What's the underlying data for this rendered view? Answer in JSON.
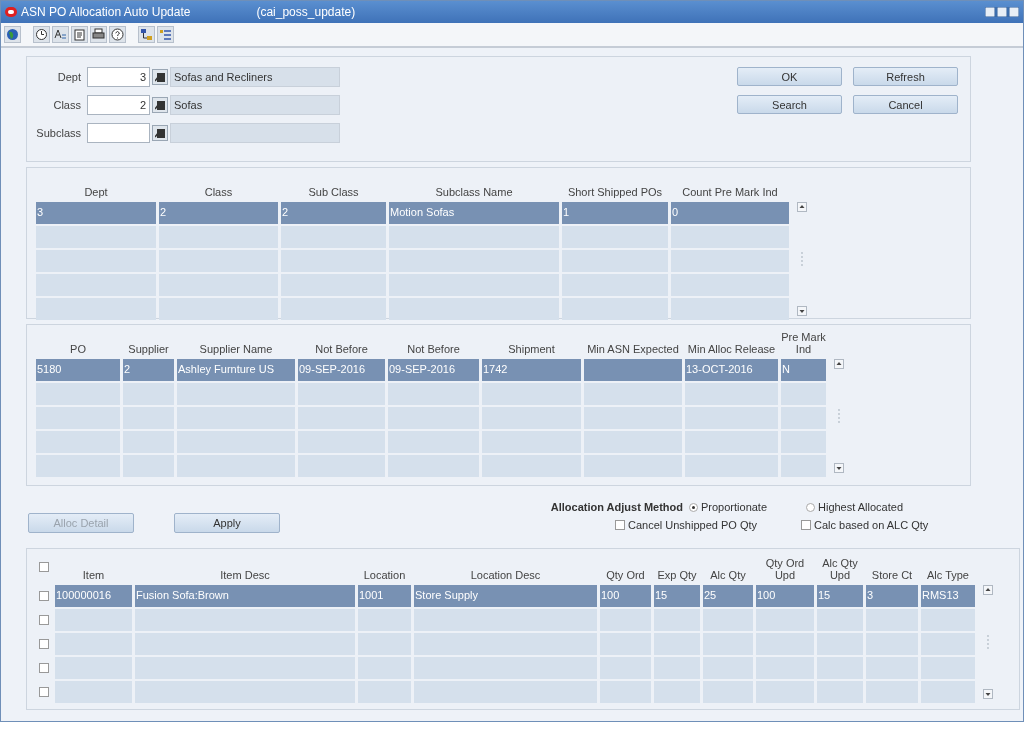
{
  "window": {
    "title": "ASN PO Allocation Auto Update",
    "module": "(cai_poss_update)"
  },
  "filters": [
    {
      "label": "Dept",
      "value": "3",
      "description": "Sofas and Recliners"
    },
    {
      "label": "Class",
      "value": "2",
      "description": "Sofas"
    },
    {
      "label": "Subclass"
    }
  ],
  "buttons": [
    "OK",
    "Refresh",
    "Search",
    "Cancel"
  ],
  "subclass_table": {
    "columns": [
      "Dept",
      "Class",
      "Sub Class",
      "Subclass Name",
      "Short Shipped POs",
      "Count Pre Mark Ind"
    ],
    "rows": [
      {
        "selected": true,
        "cells": [
          "3",
          "2",
          "2",
          "Motion Sofas",
          "1",
          "0"
        ]
      },
      {
        "selected": false,
        "cells": []
      },
      {
        "selected": false,
        "cells": []
      },
      {
        "selected": false,
        "cells": []
      },
      {
        "selected": false,
        "cells": []
      }
    ]
  },
  "po_table": {
    "columns": [
      "PO",
      "Supplier",
      "Supplier Name",
      "Not Before",
      "Not Before",
      "Shipment",
      "Min ASN Expected",
      "Min Alloc Release",
      "Pre Mark Ind"
    ],
    "rows": [
      {
        "selected": true,
        "cells": [
          "5180",
          "2",
          "Ashley Furnture US",
          "09-SEP-2016",
          "09-SEP-2016",
          "1742",
          "",
          "13-OCT-2016",
          "N"
        ]
      },
      {
        "selected": false,
        "cells": []
      },
      {
        "selected": false,
        "cells": []
      },
      {
        "selected": false,
        "cells": []
      },
      {
        "selected": false,
        "cells": []
      }
    ]
  },
  "actions": [
    {
      "label": "Alloc Detail",
      "disabled": true
    },
    {
      "label": "Apply",
      "disabled": false
    }
  ],
  "allocation_adjust_method": {
    "label": "Allocation Adjust Method",
    "options": [
      {
        "label": "Proportionate",
        "selected": true
      },
      {
        "label": "Highest Allocated",
        "selected": false
      }
    ]
  },
  "options": [
    {
      "label": "Cancel Unshipped PO Qty",
      "checked": false
    },
    {
      "label": "Calc based on ALC Qty",
      "checked": false
    }
  ],
  "item_table": {
    "select_all": false,
    "columns": [
      "Item",
      "Item Desc",
      "Location",
      "Location Desc",
      "Qty Ord",
      "Exp Qty",
      "Alc Qty",
      "Qty Ord Upd",
      "Alc Qty Upd",
      "Store Ct",
      "Alc Type"
    ],
    "rows": [
      {
        "selected": true,
        "checked": false,
        "cells": [
          "100000016",
          "Fusion Sofa:Brown",
          "1001",
          "Store Supply",
          "100",
          "15",
          "25",
          "100",
          "15",
          "3",
          "RMS13"
        ]
      },
      {
        "selected": false,
        "checked": false,
        "cells": []
      },
      {
        "selected": false,
        "checked": false,
        "cells": []
      },
      {
        "selected": false,
        "checked": false,
        "cells": []
      },
      {
        "selected": false,
        "checked": false,
        "cells": []
      }
    ]
  }
}
